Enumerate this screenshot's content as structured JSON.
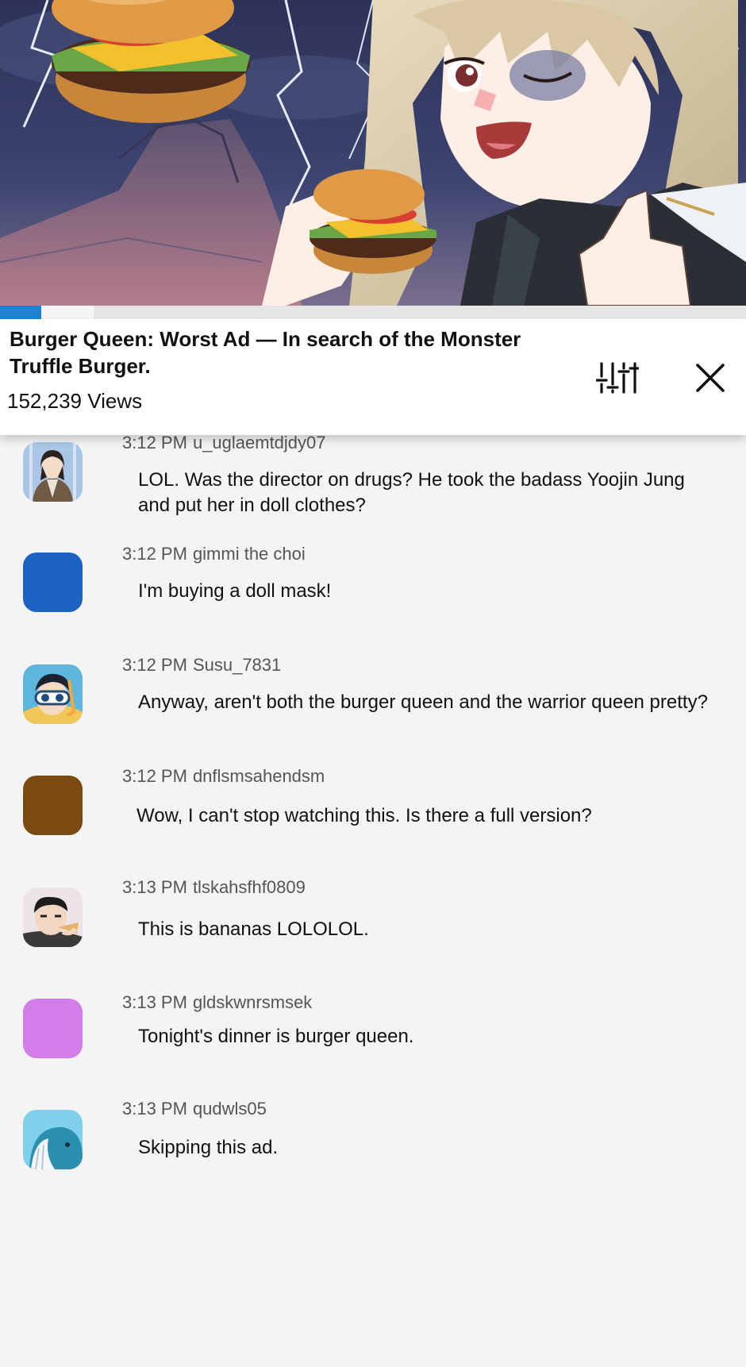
{
  "video": {
    "progress_fraction": 0.055,
    "buffered_fraction": 0.125
  },
  "info": {
    "title": "Burger Queen: Worst Ad — In search of the Monster Truffle Burger.",
    "views": "152,239 Views",
    "settings_icon": "sliders-icon",
    "close_icon": "close-icon"
  },
  "comments": [
    {
      "time": "3:12 PM",
      "user": "u_uglaemtdjdy07",
      "text": "LOL. Was the director on drugs? He took the badass Yoojin Jung and put her in doll clothes?",
      "avatar": "woman-suit-avatar"
    },
    {
      "time": "3:12 PM",
      "user": "gimmi the choi",
      "text": "I'm buying a doll mask!",
      "avatar": "blue-default-avatar",
      "avatar_color": "#1c62c3"
    },
    {
      "time": "3:12 PM",
      "user": "Susu_7831",
      "text": "Anyway, aren't both the burger queen and the warrior queen pretty?",
      "avatar": "snorkel-boy-avatar"
    },
    {
      "time": "3:12 PM",
      "user": "dnflsmsahendsm",
      "text": "Wow, I can't stop watching this. Is there a full version?",
      "avatar": "brown-default-avatar",
      "avatar_color": "#7a4a10"
    },
    {
      "time": "3:13 PM",
      "user": "tlskahsfhf0809",
      "text": "This is bananas LOLOLOL.",
      "avatar": "man-eating-avatar"
    },
    {
      "time": "3:13 PM",
      "user": "gldskwnrsmsek",
      "text": "Tonight's dinner is burger queen.",
      "avatar": "violet-default-avatar",
      "avatar_color": "#d37ee8"
    },
    {
      "time": "3:13 PM",
      "user": "qudwls05",
      "text": "Skipping this ad.",
      "avatar": "whale-avatar"
    }
  ],
  "colors": {
    "accent": "#1d82d0",
    "background": "#f4f4f4"
  }
}
